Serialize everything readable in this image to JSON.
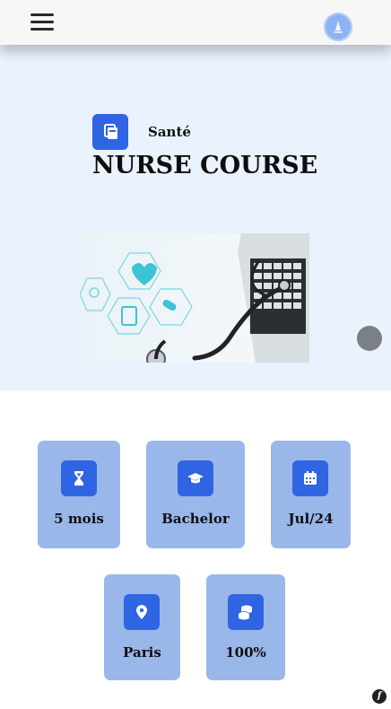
{
  "header": {
    "menu_icon": "hamburger-icon",
    "avatar_icon": "user-avatar-icon"
  },
  "hero": {
    "category": "Santé",
    "category_icon": "book-icon",
    "title": "NURSE COURSE",
    "image": "stethoscope-laptop-medical-icons-photo"
  },
  "details": [
    {
      "label": "5 mois",
      "icon": "hourglass-icon"
    },
    {
      "label": "Bachelor",
      "icon": "graduation-cap-icon"
    },
    {
      "label": "Jul/24",
      "icon": "calendar-icon"
    },
    {
      "label": "Paris",
      "icon": "location-pin-icon"
    },
    {
      "label": "100%",
      "icon": "coins-icon"
    }
  ],
  "colors": {
    "accent": "#2f64e3",
    "card_bg": "#9ab7ea",
    "hero_bg": "#e9f2fd"
  }
}
